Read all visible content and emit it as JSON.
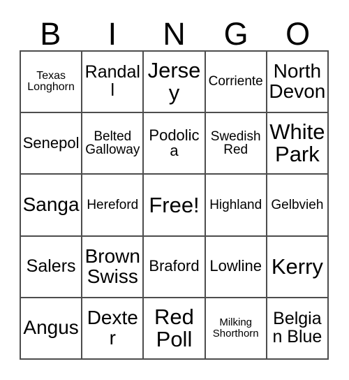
{
  "card": {
    "title": "Bingo Card",
    "header_letters": [
      "B",
      "I",
      "N",
      "G",
      "O"
    ],
    "free_space_label": "Free!",
    "grid_line_color": "#4d4d4d",
    "background_color": "#ffffff",
    "text_color": "#000000",
    "columns": 5,
    "rows": 5,
    "cells": [
      [
        {
          "label": "Texas Longhorn",
          "size": "xs",
          "free": false
        },
        {
          "label": "Randall",
          "size": "l",
          "free": false
        },
        {
          "label": "Jersey",
          "size": "xxl",
          "free": false
        },
        {
          "label": "Corriente",
          "size": "s",
          "free": false
        },
        {
          "label": "North Devon",
          "size": "xl",
          "free": false
        }
      ],
      [
        {
          "label": "Senepol",
          "size": "m",
          "free": false
        },
        {
          "label": "Belted Galloway",
          "size": "s",
          "free": false
        },
        {
          "label": "Podolica",
          "size": "m",
          "free": false
        },
        {
          "label": "Swedish Red",
          "size": "s",
          "free": false
        },
        {
          "label": "White Park",
          "size": "xxl",
          "free": false
        }
      ],
      [
        {
          "label": "Sanga",
          "size": "xl",
          "free": false
        },
        {
          "label": "Hereford",
          "size": "s",
          "free": false
        },
        {
          "label": "Free!",
          "size": "xxl",
          "free": true
        },
        {
          "label": "Highland",
          "size": "s",
          "free": false
        },
        {
          "label": "Gelbvieh",
          "size": "s",
          "free": false
        }
      ],
      [
        {
          "label": "Salers",
          "size": "l",
          "free": false
        },
        {
          "label": "Brown Swiss",
          "size": "xl",
          "free": false
        },
        {
          "label": "Braford",
          "size": "m",
          "free": false
        },
        {
          "label": "Lowline",
          "size": "m",
          "free": false
        },
        {
          "label": "Kerry",
          "size": "xxl",
          "free": false
        }
      ],
      [
        {
          "label": "Angus",
          "size": "xl",
          "free": false
        },
        {
          "label": "Dexter",
          "size": "xl",
          "free": false
        },
        {
          "label": "Red Poll",
          "size": "xxl",
          "free": false
        },
        {
          "label": "Milking Shorthorn",
          "size": "xxs",
          "free": false
        },
        {
          "label": "Belgian Blue",
          "size": "l",
          "free": false
        }
      ]
    ]
  }
}
